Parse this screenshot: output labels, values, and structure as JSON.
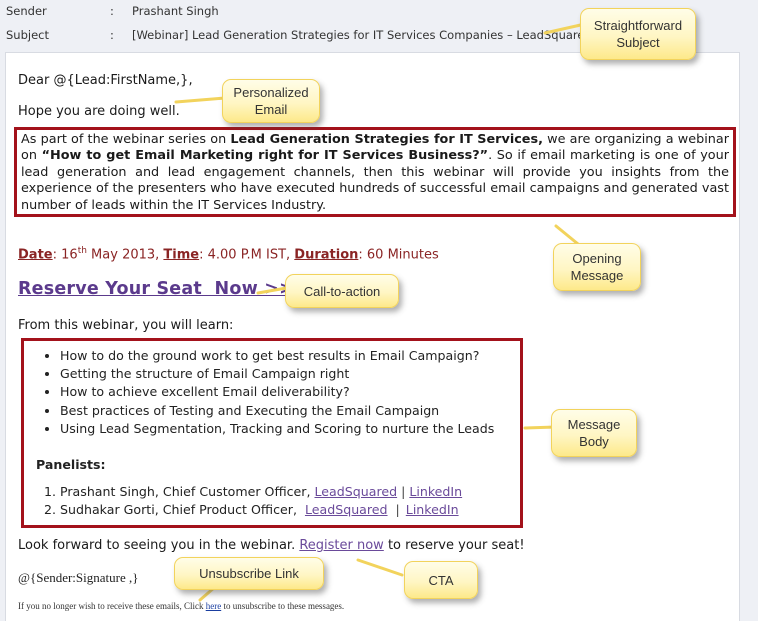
{
  "header": {
    "sender_label": "Sender",
    "subject_label": "Subject",
    "colon": ":",
    "sender_value": "Prashant Singh",
    "subject_value": "[Webinar] Lead Generation Strategies for IT Services Companies – LeadSquared"
  },
  "email": {
    "greeting": "Dear @{Lead:FirstName,},",
    "hope": "Hope you are doing well.",
    "opening": {
      "part1": "As part of the webinar series on ",
      "bold1": "Lead Generation Strategies for IT Services,",
      "part2": " we are organizing a webinar on ",
      "bold2": "“How to get Email Marketing right for IT Services Business?”",
      "part3": ". So if email marketing is one of your lead generation and lead engagement channels, then this webinar will provide you insights from the experience of the presenters who have executed hundreds of successful email campaigns and generated vast number of leads within the IT Services Industry."
    },
    "event": {
      "date_label": "Date",
      "date_day": "16",
      "date_suffix": "th",
      "date_rest": " May 2013, ",
      "time_label": "Time",
      "time_value": " 4.00 P.M IST, ",
      "duration_label": "Duration",
      "duration_value": " 60 Minutes",
      "colon": ":"
    },
    "cta_link": "Reserve Your Seat  Now >>",
    "learn_intro": "From this webinar, you will learn:",
    "bullets": [
      "How to do the ground work to get best results in Email Campaign?",
      "Getting the structure of Email Campaign right",
      "How to achieve excellent Email deliverability?",
      "Best practices of Testing and Executing the Email Campaign",
      "Using Lead Segmentation, Tracking and Scoring to nurture the Leads"
    ],
    "panelists_title": "Panelists:",
    "panelists": [
      {
        "text": "Prashant Singh, Chief Customer Officer, ",
        "company_link": "LeadSquared",
        "separator": "|",
        "profile_link": "LinkedIn"
      },
      {
        "text": "Sudhakar Gorti, Chief Product Officer,  ",
        "company_link": "LeadSquared",
        "separator": "|",
        "profile_link": "LinkedIn"
      }
    ],
    "closing_before": "Look forward to seeing you in the webinar. ",
    "closing_link": "Register now",
    "closing_after": " to reserve your seat!",
    "signature": "@{Sender:Signature ,}",
    "footer_before": "If you no longer wish to receive these emails, Click ",
    "footer_link": "here",
    "footer_after": " to unsubscribe to these messages."
  },
  "callouts": {
    "subject": "Straightforward\nSubject",
    "personalized": "Personalized\nEmail",
    "opening": "Opening\nMessage",
    "cta1": "Call-to-action",
    "body": "Message\nBody",
    "unsubscribe": "Unsubscribe Link",
    "cta2": "CTA"
  },
  "colors": {
    "highlight_border": "#a3121b",
    "link": "#6a4a9a",
    "date_text": "#8a2424",
    "callout_fill": "#fff6c4"
  }
}
